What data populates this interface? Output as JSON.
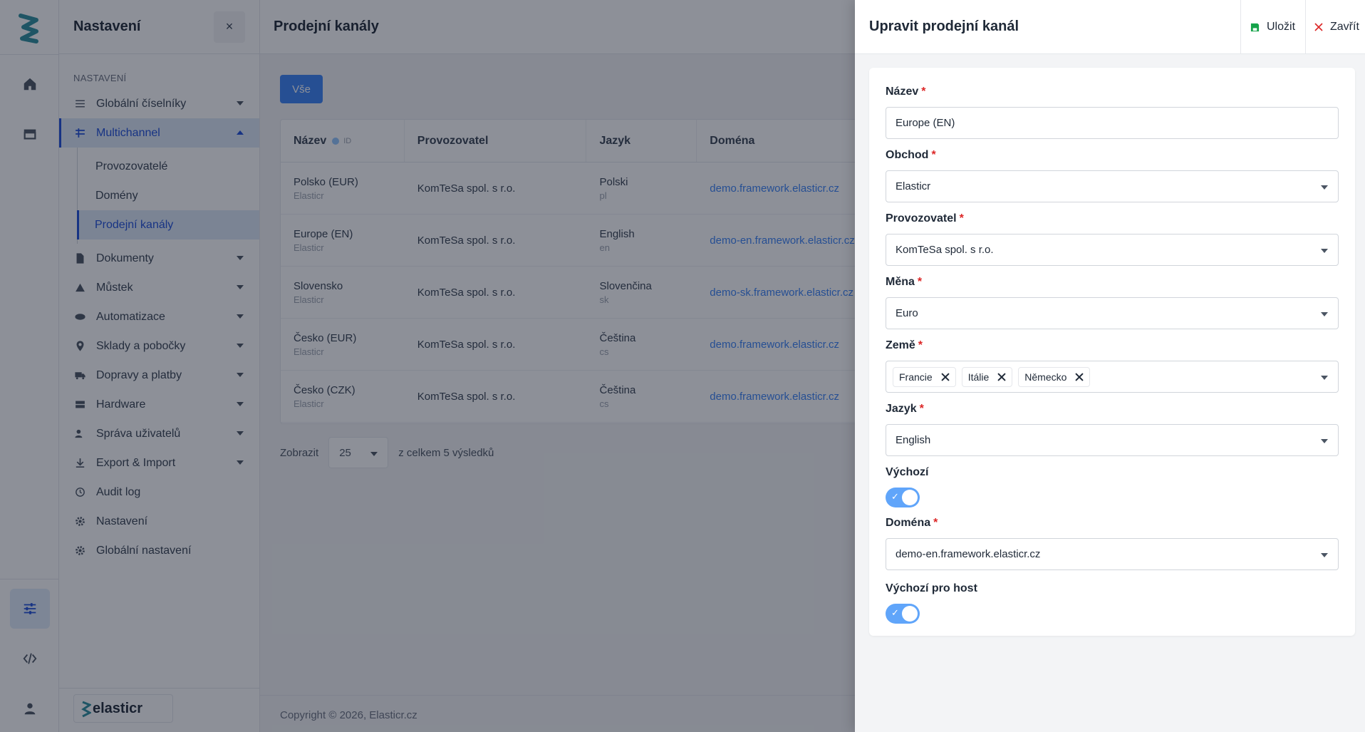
{
  "rail": {
    "items": [
      {
        "name": "home-icon"
      },
      {
        "name": "store-icon"
      },
      {
        "name": "settings-sliders-icon"
      },
      {
        "name": "code-icon"
      },
      {
        "name": "user-icon"
      }
    ]
  },
  "sidebar": {
    "title": "Nastavení",
    "close": "×",
    "section": "NASTAVENÍ",
    "items": [
      {
        "label": "Globální číselníky",
        "icon": "sliders-icon"
      },
      {
        "label": "Multichannel",
        "icon": "multichannel-icon"
      },
      {
        "label": "Dokumenty",
        "icon": "document-icon"
      },
      {
        "label": "Můstek",
        "icon": "bridge-icon"
      },
      {
        "label": "Automatizace",
        "icon": "automation-icon"
      },
      {
        "label": "Sklady a pobočky",
        "icon": "location-icon"
      },
      {
        "label": "Dopravy a platby",
        "icon": "truck-icon"
      },
      {
        "label": "Hardware",
        "icon": "hardware-icon"
      },
      {
        "label": "Správa uživatelů",
        "icon": "users-icon"
      },
      {
        "label": "Export & Import",
        "icon": "download-icon"
      },
      {
        "label": "Audit log",
        "icon": "history-icon"
      },
      {
        "label": "Nastavení",
        "icon": "gear-icon"
      },
      {
        "label": "Globální nastavení",
        "icon": "gear-icon"
      }
    ],
    "sub_items": [
      "Provozovatelé",
      "Domény",
      "Prodejní kanály"
    ],
    "brand": "elasticr"
  },
  "main": {
    "title": "Prodejní kanály",
    "filter_all": "Vše",
    "columns": {
      "name": "Název",
      "id": "ID",
      "operator": "Provozovatel",
      "language": "Jazyk",
      "domain": "Doména"
    },
    "rows": [
      {
        "name": "Polsko (EUR)",
        "shop": "Elasticr",
        "operator": "KomTeSa spol. s r.o.",
        "language": "Polski",
        "lang_code": "pl",
        "domain": "demo.framework.elasticr.cz"
      },
      {
        "name": "Europe (EN)",
        "shop": "Elasticr",
        "operator": "KomTeSa spol. s r.o.",
        "language": "English",
        "lang_code": "en",
        "domain": "demo-en.framework.elasticr.cz"
      },
      {
        "name": "Slovensko",
        "shop": "Elasticr",
        "operator": "KomTeSa spol. s r.o.",
        "language": "Slovenčina",
        "lang_code": "sk",
        "domain": "demo-sk.framework.elasticr.cz"
      },
      {
        "name": "Česko (EUR)",
        "shop": "Elasticr",
        "operator": "KomTeSa spol. s r.o.",
        "language": "Čeština",
        "lang_code": "cs",
        "domain": "demo.framework.elasticr.cz"
      },
      {
        "name": "Česko (CZK)",
        "shop": "Elasticr",
        "operator": "KomTeSa spol. s r.o.",
        "language": "Čeština",
        "lang_code": "cs",
        "domain": "demo.framework.elasticr.cz"
      }
    ],
    "pager": {
      "show_label": "Zobrazit",
      "page_size": "25",
      "total": "z celkem 5 výsledků"
    },
    "copyright": "Copyright © 2026, Elasticr.cz"
  },
  "drawer": {
    "title": "Upravit prodejní kanál",
    "save": "Uložit",
    "close": "Zavřít",
    "required_mark": "*",
    "fields": {
      "name": {
        "label": "Název",
        "value": "Europe (EN)"
      },
      "shop": {
        "label": "Obchod",
        "value": "Elasticr"
      },
      "operator": {
        "label": "Provozovatel",
        "value": "KomTeSa spol. s r.o."
      },
      "currency": {
        "label": "Měna",
        "value": "Euro"
      },
      "countries": {
        "label": "Země",
        "tags": [
          "Francie",
          "Itálie",
          "Německo"
        ]
      },
      "language": {
        "label": "Jazyk",
        "value": "English"
      },
      "default": {
        "label": "Výchozí",
        "on": true
      },
      "domain": {
        "label": "Doména",
        "value": "demo-en.framework.elasticr.cz"
      },
      "default_host": {
        "label": "Výchozí pro host",
        "on": true
      }
    }
  },
  "colors": {
    "accent": "#3b82f6",
    "required": "#dc2626",
    "save_icon": "#16a34a",
    "close_icon": "#dc2626"
  }
}
